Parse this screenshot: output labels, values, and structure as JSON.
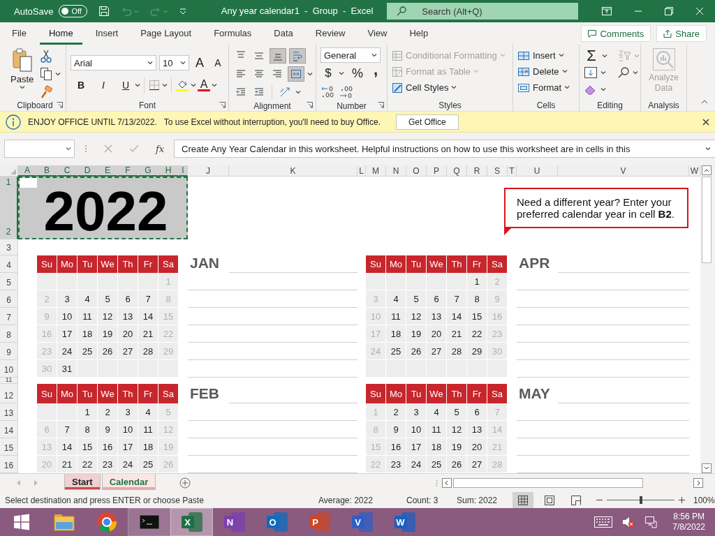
{
  "title_bar": {
    "autosave_label": "AutoSave",
    "autosave": {
      "on": false,
      "label": "Off"
    },
    "title": "Any year calendar1  -  Group  -  Excel",
    "search": {
      "placeholder": "Search (Alt+Q)"
    }
  },
  "menu_tabs": [
    {
      "label": "File",
      "selected": false
    },
    {
      "label": "Home",
      "selected": true
    },
    {
      "label": "Insert",
      "selected": false
    },
    {
      "label": "Page Layout",
      "selected": false
    },
    {
      "label": "Formulas",
      "selected": false
    },
    {
      "label": "Data",
      "selected": false
    },
    {
      "label": "Review",
      "selected": false
    },
    {
      "label": "View",
      "selected": false
    },
    {
      "label": "Help",
      "selected": false
    }
  ],
  "header_buttons": [
    "Comments",
    "Share"
  ],
  "ribbon": {
    "clipboard": {
      "label": "Clipboard",
      "paste": "Paste"
    },
    "font": {
      "label": "Font",
      "font_name": "Arial",
      "font_size": "10",
      "grow": "A",
      "shrink": "A",
      "bold": "B",
      "italic": "I",
      "underline": "U",
      "font_color": "A"
    },
    "alignment": {
      "label": "Alignment",
      "buttons": [
        {
          "kind": "top",
          "selected": false
        },
        {
          "kind": "middle",
          "selected": false
        },
        {
          "kind": "bottom",
          "selected": true
        },
        {
          "kind": "wrap",
          "selected": true
        },
        {
          "kind": "left",
          "selected": false
        },
        {
          "kind": "center",
          "selected": false
        },
        {
          "kind": "right",
          "selected": false
        },
        {
          "kind": "merge",
          "selected": true
        },
        {
          "kind": "outdent",
          "selected": false
        },
        {
          "kind": "indent",
          "selected": false
        },
        {
          "kind": "orientation",
          "selected": false
        }
      ]
    },
    "number": {
      "label": "Number",
      "format": "General",
      "currency": "$",
      "percent": "%",
      "comma": ","
    },
    "styles": {
      "label": "Styles",
      "items": [
        {
          "kind": "conditional",
          "label": "Conditional Formatting",
          "disabled": true
        },
        {
          "kind": "table",
          "label": "Format as Table",
          "disabled": true
        },
        {
          "kind": "cell",
          "label": "Cell Styles",
          "disabled": false
        }
      ]
    },
    "cells": {
      "label": "Cells",
      "items": [
        {
          "kind": "insert",
          "label": "Insert"
        },
        {
          "kind": "delete",
          "label": "Delete"
        },
        {
          "kind": "format",
          "label": "Format"
        }
      ]
    },
    "editing": {
      "label": "Editing",
      "autosum": "Σ"
    },
    "analysis": {
      "label": "Analysis",
      "button": "Analyze Data",
      "disabled": true
    }
  },
  "info_bar": {
    "heading": "ENJOY OFFICE UNTIL 7/13/2022.",
    "message": "To use Excel without interruption, you'll need to buy Office.",
    "button": "Get Office"
  },
  "formula_bar": {
    "function_label": "fx",
    "formula": "Create Any Year Calendar in this worksheet. Helpful instructions on how to use this worksheet are in cells in this"
  },
  "columns": [
    {
      "label": "A",
      "selected": true
    },
    {
      "label": "B",
      "selected": true
    },
    {
      "label": "C",
      "selected": true
    },
    {
      "label": "D",
      "selected": true
    },
    {
      "label": "E",
      "selected": true
    },
    {
      "label": "F",
      "selected": true
    },
    {
      "label": "G",
      "selected": true
    },
    {
      "label": "H",
      "selected": true
    },
    {
      "label": "I",
      "selected": true
    },
    {
      "label": "J",
      "selected": false
    },
    {
      "label": "K",
      "selected": false
    },
    {
      "label": "L",
      "selected": false
    },
    {
      "label": "M",
      "selected": false
    },
    {
      "label": "N",
      "selected": false
    },
    {
      "label": "O",
      "selected": false
    },
    {
      "label": "P",
      "selected": false
    },
    {
      "label": "Q",
      "selected": false
    },
    {
      "label": "R",
      "selected": false
    },
    {
      "label": "S",
      "selected": false
    },
    {
      "label": "T",
      "selected": false
    },
    {
      "label": "U",
      "selected": false
    },
    {
      "label": "V",
      "selected": false
    },
    {
      "label": "W",
      "selected": false
    }
  ],
  "rows": [
    {
      "label": "1",
      "selected": true
    },
    {
      "label": "2",
      "selected": true
    },
    {
      "label": "3",
      "selected": false
    },
    {
      "label": "4",
      "selected": false
    },
    {
      "label": "5",
      "selected": false
    },
    {
      "label": "6",
      "selected": false
    },
    {
      "label": "7",
      "selected": false
    },
    {
      "label": "8",
      "selected": false
    },
    {
      "label": "9",
      "selected": false
    },
    {
      "label": "10",
      "selected": false
    },
    {
      "label": "11",
      "selected": false
    },
    {
      "label": "12",
      "selected": false
    },
    {
      "label": "13",
      "selected": false
    },
    {
      "label": "14",
      "selected": false
    },
    {
      "label": "15",
      "selected": false
    },
    {
      "label": "16",
      "selected": false
    }
  ],
  "year_cell": "2022",
  "callout": "Need a different year? Enter your preferred calendar year in cell **B2**.",
  "months": [
    {
      "name": "JAN",
      "days": [
        "Su",
        "Mo",
        "Tu",
        "We",
        "Th",
        "Fr",
        "Sa"
      ],
      "weeks": [
        [
          {
            "kind": "blank"
          },
          {
            "kind": "blank"
          },
          {
            "kind": "blank"
          },
          {
            "kind": "blank"
          },
          {
            "kind": "blank"
          },
          {
            "kind": "blank"
          },
          "1"
        ],
        [
          "2",
          "3",
          "4",
          "5",
          "6",
          "7",
          "8"
        ],
        [
          "9",
          "10",
          "11",
          "12",
          "13",
          "14",
          "15"
        ],
        [
          "16",
          "17",
          "18",
          "19",
          "20",
          "21",
          "22"
        ],
        [
          "23",
          "24",
          "25",
          "26",
          "27",
          "28",
          "29"
        ],
        [
          "30",
          "31",
          {
            "kind": "blank"
          },
          {
            "kind": "blank"
          },
          {
            "kind": "blank"
          },
          {
            "kind": "blank"
          },
          {
            "kind": "blank"
          }
        ]
      ]
    },
    {
      "name": "APR",
      "days": [
        "Su",
        "Mo",
        "Tu",
        "We",
        "Th",
        "Fr",
        "Sa"
      ],
      "weeks": [
        [
          {
            "kind": "blank"
          },
          {
            "kind": "blank"
          },
          {
            "kind": "blank"
          },
          {
            "kind": "blank"
          },
          {
            "kind": "blank"
          },
          "1",
          "2"
        ],
        [
          "3",
          "4",
          "5",
          "6",
          "7",
          "8",
          "9"
        ],
        [
          "10",
          "11",
          "12",
          "13",
          "14",
          "15",
          "16"
        ],
        [
          "17",
          "18",
          "19",
          "20",
          "21",
          "22",
          "23"
        ],
        [
          "24",
          "25",
          "26",
          "27",
          "28",
          "29",
          "30"
        ],
        [
          {
            "kind": "blank"
          },
          {
            "kind": "blank"
          },
          {
            "kind": "blank"
          },
          {
            "kind": "blank"
          },
          {
            "kind": "blank"
          },
          {
            "kind": "blank"
          },
          {
            "kind": "blank"
          }
        ]
      ]
    },
    {
      "name": "FEB",
      "days": [
        "Su",
        "Mo",
        "Tu",
        "We",
        "Th",
        "Fr",
        "Sa"
      ],
      "weeks": [
        [
          {
            "kind": "blank"
          },
          {
            "kind": "blank"
          },
          "1",
          "2",
          "3",
          "4",
          "5"
        ],
        [
          "6",
          "7",
          "8",
          "9",
          "10",
          "11",
          "12"
        ],
        [
          "13",
          "14",
          "15",
          "16",
          "17",
          "18",
          "19"
        ],
        [
          "20",
          "21",
          "22",
          "23",
          "24",
          "25",
          "26"
        ]
      ]
    },
    {
      "name": "MAY",
      "days": [
        "Su",
        "Mo",
        "Tu",
        "We",
        "Th",
        "Fr",
        "Sa"
      ],
      "weeks": [
        [
          "1",
          "2",
          "3",
          "4",
          "5",
          "6",
          "7"
        ],
        [
          "8",
          "9",
          "10",
          "11",
          "12",
          "13",
          "14"
        ],
        [
          "15",
          "16",
          "17",
          "18",
          "19",
          "20",
          "21"
        ],
        [
          "22",
          "23",
          "24",
          "25",
          "26",
          "27",
          "28"
        ]
      ]
    }
  ],
  "sheet_tabs": [
    {
      "label": "Start",
      "selected": false
    },
    {
      "label": "Calendar",
      "selected": true
    }
  ],
  "status_bar": {
    "message": "Select destination and press ENTER or choose Paste",
    "average": "Average: 2022",
    "count": "Count: 3",
    "sum": "Sum: 2022",
    "views": [
      {
        "kind": "normal",
        "selected": true
      },
      {
        "kind": "page_layout",
        "selected": false
      },
      {
        "kind": "page_break",
        "selected": false
      }
    ],
    "zoom_slider": {
      "level": 0.5
    },
    "zoom": "100%"
  },
  "taskbar": {
    "apps": [
      {
        "kind": "explorer",
        "open": false,
        "selected": false
      },
      {
        "kind": "chrome",
        "open": false,
        "selected": false
      },
      {
        "kind": "terminal",
        "open": true,
        "selected": false
      },
      {
        "kind": "excel",
        "letter": "X",
        "open": true,
        "selected": true
      },
      {
        "kind": "onenote",
        "letter": "N",
        "open": false,
        "selected": false
      },
      {
        "kind": "outlook",
        "letter": "O",
        "open": false,
        "selected": false
      },
      {
        "kind": "powerpoint",
        "letter": "P",
        "open": false,
        "selected": false
      },
      {
        "kind": "visio",
        "letter": "V",
        "open": false,
        "selected": false
      },
      {
        "kind": "word",
        "letter": "W",
        "open": false,
        "selected": false
      }
    ],
    "time": "8:56 PM",
    "date": "7/8/2022"
  }
}
